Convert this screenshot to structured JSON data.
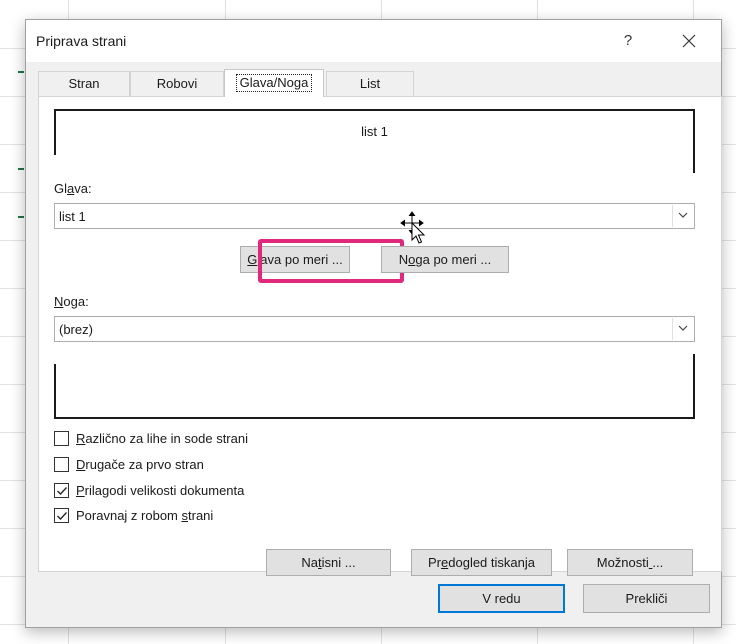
{
  "dialog": {
    "title": "Priprava strani",
    "help_label": "?"
  },
  "tabs": [
    {
      "label": "Stran",
      "active": false
    },
    {
      "label": "Robovi",
      "active": false
    },
    {
      "label": "Glava/Noga",
      "active": true
    },
    {
      "label": "List",
      "active": false
    }
  ],
  "header_preview_text": "list 1",
  "header": {
    "label_pre": "Gl",
    "label_u": "a",
    "label_post": "va:",
    "value": "list 1",
    "custom_button_u": "G",
    "custom_button_rest": "lava po meri ..."
  },
  "footer": {
    "label_u": "N",
    "label_post": "oga:",
    "value": "(brez)",
    "custom_button_pre": "N",
    "custom_button_u": "o",
    "custom_button_rest": "ga po meri ..."
  },
  "options": [
    {
      "u": "R",
      "rest": "azlično za lihe in sode strani",
      "pre": "",
      "checked": false
    },
    {
      "u": "D",
      "rest": "rugače za prvo stran",
      "pre": "",
      "checked": false
    },
    {
      "u": "P",
      "rest": "rilagodi velikosti dokumenta",
      "pre": "",
      "checked": true
    },
    {
      "pre": "Poravnaj z robom ",
      "u": "s",
      "rest": "trani",
      "checked": true
    }
  ],
  "actions": {
    "print_pre": "Na",
    "print_u": "t",
    "print_rest": "isni ...",
    "preview_pre": "Pr",
    "preview_u": "e",
    "preview_rest": "dogled tiskanja",
    "options_pre": "Možnosti",
    "options_u": " ",
    "options_rest": "...",
    "ok": "V redu",
    "cancel": "Prekliči"
  },
  "colors": {
    "highlight": "#e0287d",
    "primary_border": "#0078d7",
    "sheet_green": "#217346"
  }
}
